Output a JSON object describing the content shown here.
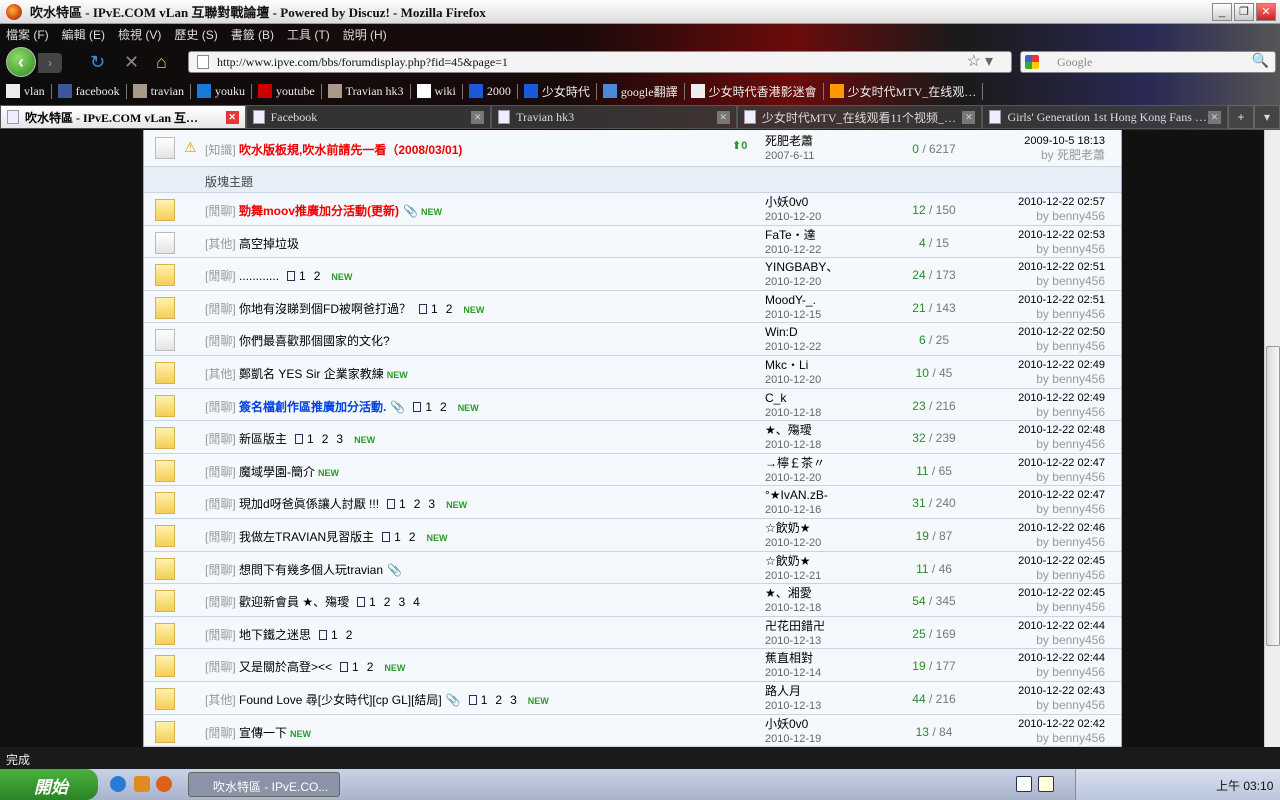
{
  "window": {
    "title": "吹水特區 - IPvE.COM vLan 互聯對戰論壇 - Powered by Discuz! - Mozilla Firefox"
  },
  "menu": [
    "檔案 (F)",
    "編輯 (E)",
    "檢視 (V)",
    "歷史 (S)",
    "書籤 (B)",
    "工具 (T)",
    "說明 (H)"
  ],
  "url": "http://www.ipve.com/bbs/forumdisplay.php?fid=45&page=1",
  "search_placeholder": "Google",
  "bookmarks": [
    "vlan",
    "facebook",
    "travian",
    "youku",
    "youtube",
    "Travian hk3",
    "wiki",
    "2000",
    "少女時代",
    "google翻譯",
    "少女時代香港影迷會",
    "少女时代MTV_在线观…"
  ],
  "tabs": [
    "吹水特區 - IPvE.COM vLan 互…",
    "Facebook",
    "Travian hk3",
    "少女时代MTV_在线观看11个视频_…",
    "Girls' Generation 1st Hong Kong Fans …"
  ],
  "pinned": {
    "prefix": "[知識]",
    "title": "吹水版板規,吹水前請先一看（2008/03/01)",
    "author": "死肥老蕭",
    "date": "2007-6-11",
    "replies": "0",
    "views": "6217",
    "last_time": "2009-10-5 18:13",
    "last_by": "by 死肥老蕭"
  },
  "section_header": "版塊主題",
  "threads": [
    {
      "prefix": "[閒聊]",
      "title": "勁舞moov推廣加分活動(更新)",
      "style": "red",
      "attach": true,
      "pages": [],
      "new": "NEW",
      "author": "小妖0v0",
      "date": "2010-12-20",
      "replies": "12",
      "views": "150",
      "last_time": "2010-12-22 02:57",
      "last_by": "benny456"
    },
    {
      "prefix": "[其他]",
      "title": "高空掉垃圾",
      "style": "",
      "attach": false,
      "pages": [],
      "new": "",
      "gray": true,
      "author": "FaTe・達",
      "date": "2010-12-22",
      "replies": "4",
      "views": "15",
      "last_time": "2010-12-22 02:53",
      "last_by": "benny456"
    },
    {
      "prefix": "[閒聊]",
      "title": "............",
      "style": "",
      "attach": false,
      "pages": [
        "1",
        "2"
      ],
      "new": "NEW",
      "author": "YINGBABY、",
      "date": "2010-12-20",
      "replies": "24",
      "views": "173",
      "last_time": "2010-12-22 02:51",
      "last_by": "benny456"
    },
    {
      "prefix": "[閒聊]",
      "title": "你地有沒睇到個FD被啊爸打過？",
      "style": "",
      "attach": false,
      "pages": [
        "1",
        "2"
      ],
      "new": "NEW",
      "author": "MoodY-_.",
      "date": "2010-12-15",
      "replies": "21",
      "views": "143",
      "last_time": "2010-12-22 02:51",
      "last_by": "benny456"
    },
    {
      "prefix": "[閒聊]",
      "title": "你們最喜歡那個國家的文化?",
      "style": "",
      "attach": false,
      "pages": [],
      "new": "",
      "gray": true,
      "author": "Win:D",
      "date": "2010-12-22",
      "replies": "6",
      "views": "25",
      "last_time": "2010-12-22 02:50",
      "last_by": "benny456"
    },
    {
      "prefix": "[其他]",
      "title": "鄭凱名 YES Sir 企業家教練",
      "style": "",
      "attach": false,
      "pages": [],
      "new": "NEW",
      "author": "Mkc・Li",
      "date": "2010-12-20",
      "replies": "10",
      "views": "45",
      "last_time": "2010-12-22 02:49",
      "last_by": "benny456"
    },
    {
      "prefix": "[閒聊]",
      "title": "簽名檔創作區推廣加分活動.",
      "style": "blue",
      "attach": true,
      "pages": [
        "1",
        "2"
      ],
      "new": "NEW",
      "author": "C_k",
      "date": "2010-12-18",
      "replies": "23",
      "views": "216",
      "last_time": "2010-12-22 02:49",
      "last_by": "benny456"
    },
    {
      "prefix": "[閒聊]",
      "title": "新區版主",
      "style": "",
      "attach": false,
      "pages": [
        "1",
        "2",
        "3"
      ],
      "new": "NEW",
      "author": "★、殤璦",
      "date": "2010-12-18",
      "replies": "32",
      "views": "239",
      "last_time": "2010-12-22 02:48",
      "last_by": "benny456"
    },
    {
      "prefix": "[閒聊]",
      "title": "魔域學園-簡介",
      "style": "",
      "attach": false,
      "pages": [],
      "new": "NEW",
      "author": "→檸￡茶〃",
      "date": "2010-12-20",
      "replies": "11",
      "views": "65",
      "last_time": "2010-12-22 02:47",
      "last_by": "benny456"
    },
    {
      "prefix": "[閒聊]",
      "title": "現加d呀爸眞係讓人討厭 !!!",
      "style": "",
      "attach": false,
      "pages": [
        "1",
        "2",
        "3"
      ],
      "new": "NEW",
      "author": "°★IvAN.zB-",
      "date": "2010-12-16",
      "replies": "31",
      "views": "240",
      "last_time": "2010-12-22 02:47",
      "last_by": "benny456"
    },
    {
      "prefix": "[閒聊]",
      "title": "我做左TRAVIAN見習版主",
      "style": "",
      "attach": false,
      "pages": [
        "1",
        "2"
      ],
      "new": "NEW",
      "author": "☆飲奶★",
      "date": "2010-12-20",
      "replies": "19",
      "views": "87",
      "last_time": "2010-12-22 02:46",
      "last_by": "benny456"
    },
    {
      "prefix": "[閒聊]",
      "title": "想問下有幾多個人玩travian",
      "style": "",
      "attach": true,
      "pages": [],
      "new": "",
      "author": "☆飲奶★",
      "date": "2010-12-21",
      "replies": "11",
      "views": "46",
      "last_time": "2010-12-22 02:45",
      "last_by": "benny456"
    },
    {
      "prefix": "[閒聊]",
      "title": "歡迎新會員 ★、殤璦",
      "style": "",
      "attach": false,
      "pages": [
        "1",
        "2",
        "3",
        "4"
      ],
      "new": "",
      "author": "★、湘愛",
      "date": "2010-12-18",
      "replies": "54",
      "views": "345",
      "last_time": "2010-12-22 02:45",
      "last_by": "benny456"
    },
    {
      "prefix": "[閒聊]",
      "title": "地下鐵之迷思",
      "style": "",
      "attach": false,
      "pages": [
        "1",
        "2"
      ],
      "new": "",
      "author": "卍花田錯卍",
      "date": "2010-12-13",
      "replies": "25",
      "views": "169",
      "last_time": "2010-12-22 02:44",
      "last_by": "benny456"
    },
    {
      "prefix": "[閒聊]",
      "title": "又是關於高登><<",
      "style": "",
      "attach": false,
      "pages": [
        "1",
        "2"
      ],
      "new": "NEW",
      "author": "蕉直相對",
      "date": "2010-12-14",
      "replies": "19",
      "views": "177",
      "last_time": "2010-12-22 02:44",
      "last_by": "benny456"
    },
    {
      "prefix": "[其他]",
      "title": "Found Love 尋[少女時代][cp GL][結局]",
      "style": "",
      "attach": true,
      "pages": [
        "1",
        "2",
        "3"
      ],
      "new": "NEW",
      "author": "路人月",
      "date": "2010-12-13",
      "replies": "44",
      "views": "216",
      "last_time": "2010-12-22 02:43",
      "last_by": "benny456"
    },
    {
      "prefix": "[閒聊]",
      "title": "宣傳一下",
      "style": "",
      "attach": false,
      "pages": [],
      "new": "NEW",
      "author": "小妖0v0",
      "date": "2010-12-19",
      "replies": "13",
      "views": "84",
      "last_time": "2010-12-22 02:42",
      "last_by": "benny456"
    }
  ],
  "by_label": "by",
  "status": "完成",
  "taskbar": {
    "start": "開始",
    "app": "吹水特區 - IPvE.CO...",
    "clock": "上午 03:10"
  }
}
